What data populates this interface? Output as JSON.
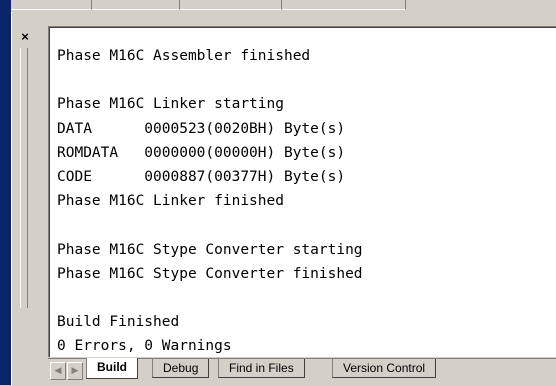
{
  "output_lines": [
    "Phase M16C Assembler finished",
    "",
    "Phase M16C Linker starting",
    "DATA      0000523(0020BH) Byte(s)",
    "ROMDATA   0000000(00000H) Byte(s)",
    "CODE      0000887(00377H) Byte(s)",
    "Phase M16C Linker finished",
    "",
    "Phase M16C Stype Converter starting",
    "Phase M16C Stype Converter finished",
    "",
    "Build Finished",
    "0 Errors, 0 Warnings"
  ],
  "window": {
    "close_glyph": "×"
  },
  "tabs": [
    {
      "label": "Build",
      "active": true
    },
    {
      "label": "Debug",
      "active": false
    },
    {
      "label": "Find in Files",
      "active": false
    },
    {
      "label": "Version Control",
      "active": false
    }
  ]
}
